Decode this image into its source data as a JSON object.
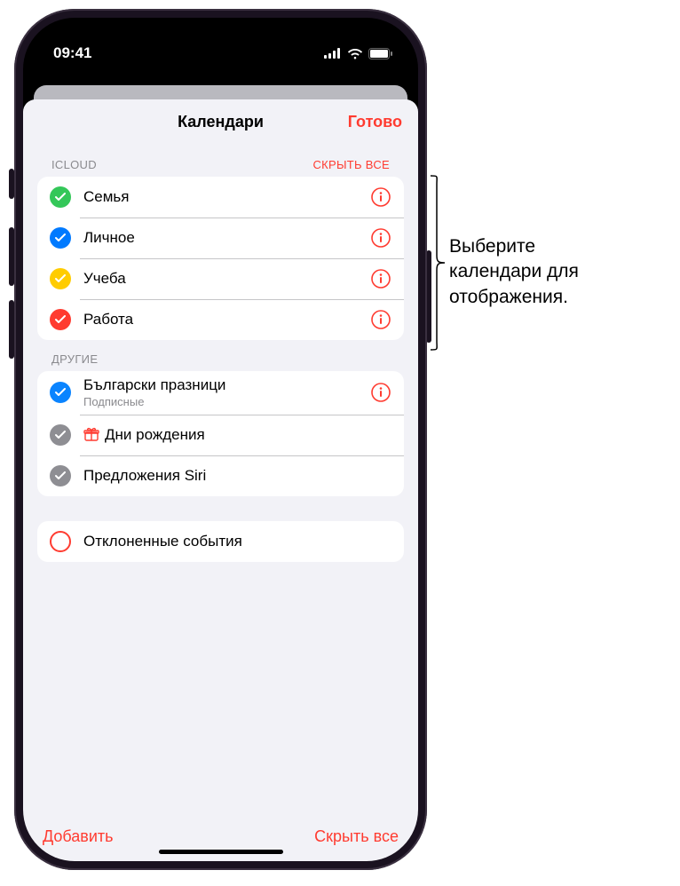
{
  "status": {
    "time": "09:41"
  },
  "sheet": {
    "title": "Календари",
    "done": "Готово"
  },
  "sections": {
    "icloud": {
      "header": "ICLOUD",
      "hide_all": "СКРЫТЬ ВСЕ",
      "items": [
        {
          "label": "Семья",
          "color": "#34c759"
        },
        {
          "label": "Личное",
          "color": "#007aff"
        },
        {
          "label": "Учеба",
          "color": "#ffcc00"
        },
        {
          "label": "Работа",
          "color": "#ff3b30"
        }
      ]
    },
    "other": {
      "header": "ДРУГИЕ",
      "items": [
        {
          "label": "Български празници",
          "sub": "Подписные",
          "color": "#0a84ff",
          "info": true
        },
        {
          "label": "Дни рождения",
          "color": "#8e8e93",
          "gift": true
        },
        {
          "label": "Предложения Siri",
          "color": "#8e8e93"
        }
      ]
    },
    "declined": {
      "label": "Отклоненные события"
    }
  },
  "toolbar": {
    "add": "Добавить",
    "hide_all": "Скрыть все"
  },
  "callout": {
    "line1": "Выберите",
    "line2": "календари для",
    "line3": "отображения."
  }
}
